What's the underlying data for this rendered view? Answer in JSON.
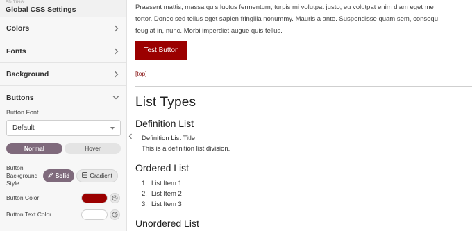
{
  "sidebar": {
    "editing_label": "EDITING:",
    "title": "Global CSS Settings",
    "sections": [
      {
        "label": "Colors"
      },
      {
        "label": "Fonts"
      },
      {
        "label": "Background"
      },
      {
        "label": "Buttons"
      }
    ],
    "buttons_panel": {
      "font_label": "Button Font",
      "font_value": "Default",
      "states": [
        "Normal",
        "Hover"
      ],
      "bg_style_label": "Button Background Style",
      "bg_style_options": [
        "Solid",
        "Gradient"
      ],
      "button_color_label": "Button Color",
      "button_color_value": "#9b0000",
      "button_text_color_label": "Button Text Color",
      "button_text_color_value": "#ffffff"
    }
  },
  "main": {
    "paragraph_lines": [
      "Praesent mattis, massa quis luctus fermentum, turpis mi volutpat justo, eu volutpat enim diam eget me",
      "tortor. Donec sed tellus eget sapien fringilla nonummy. Mauris a ante. Suspendisse quam sem, consequ",
      "feugiat in, nunc. Morbi imperdiet augue quis tellus."
    ],
    "test_button_label": "Test Button",
    "top_link": "[top]",
    "list_types_heading": "List Types",
    "definition_list_heading": "Definition List",
    "definition_title": "Definition List Title",
    "definition_desc": "This is a definition list division.",
    "ordered_list_heading": "Ordered List",
    "ordered_items": [
      "List Item 1",
      "List Item 2",
      "List Item 3"
    ],
    "unordered_list_heading": "Unordered List"
  },
  "colors": {
    "accent": "#7f6a7c",
    "button_red": "#9b0000"
  }
}
